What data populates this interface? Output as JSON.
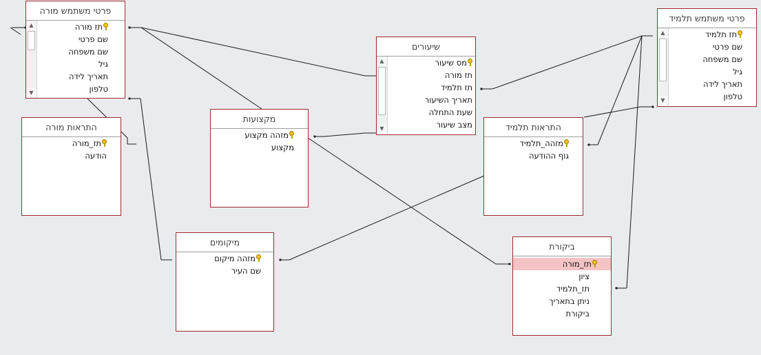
{
  "tables": {
    "teacher_user": {
      "title": "פרטי משתמש מורה",
      "fields": [
        "תז מורה",
        "שם פרטי",
        "שם משפחה",
        "גיל",
        "תאריך לידה",
        "טלפון"
      ]
    },
    "teacher_alerts": {
      "title": "התראות מורה",
      "fields": [
        "תז_מורה",
        "הודעה"
      ]
    },
    "professions": {
      "title": "מקצועות",
      "fields": [
        "מזהה מקצוע",
        "מקצוע"
      ]
    },
    "lessons": {
      "title": "שיעורים",
      "fields": [
        "מס שיעור",
        "תז מורה",
        "תז תלמיד",
        "תאריך השיעור",
        "שעת התחלה",
        "מצב שיעור"
      ]
    },
    "locations": {
      "title": "מיקומים",
      "fields": [
        "מזהה מיקום",
        "שם העיר"
      ]
    },
    "student_alerts": {
      "title": "התראות תלמיד",
      "fields": [
        "מזהה_תלמיד",
        "גוף ההודעה"
      ]
    },
    "reviews": {
      "title": "ביקורת",
      "fields": [
        "תז_מורה",
        "ציון",
        "תז_תלמיד",
        "ניתן בתאריך",
        "ביקורת"
      ]
    },
    "student_user": {
      "title": "פרטי משתמש תלמיד",
      "fields": [
        "תז תלמיד",
        "שם פרטי",
        "שם משפחה",
        "גיל",
        "תאריך לידה",
        "טלפון"
      ]
    }
  },
  "icons": {
    "primary_key": "key-icon",
    "scroll_up": "arrow-up-icon",
    "scroll_down": "arrow-down-icon"
  },
  "colors": {
    "background": "#e9ebee",
    "table_border": "#9e2a2f",
    "selected_field": "#f4c3c4",
    "relationship_line": "#1b1b1b"
  }
}
